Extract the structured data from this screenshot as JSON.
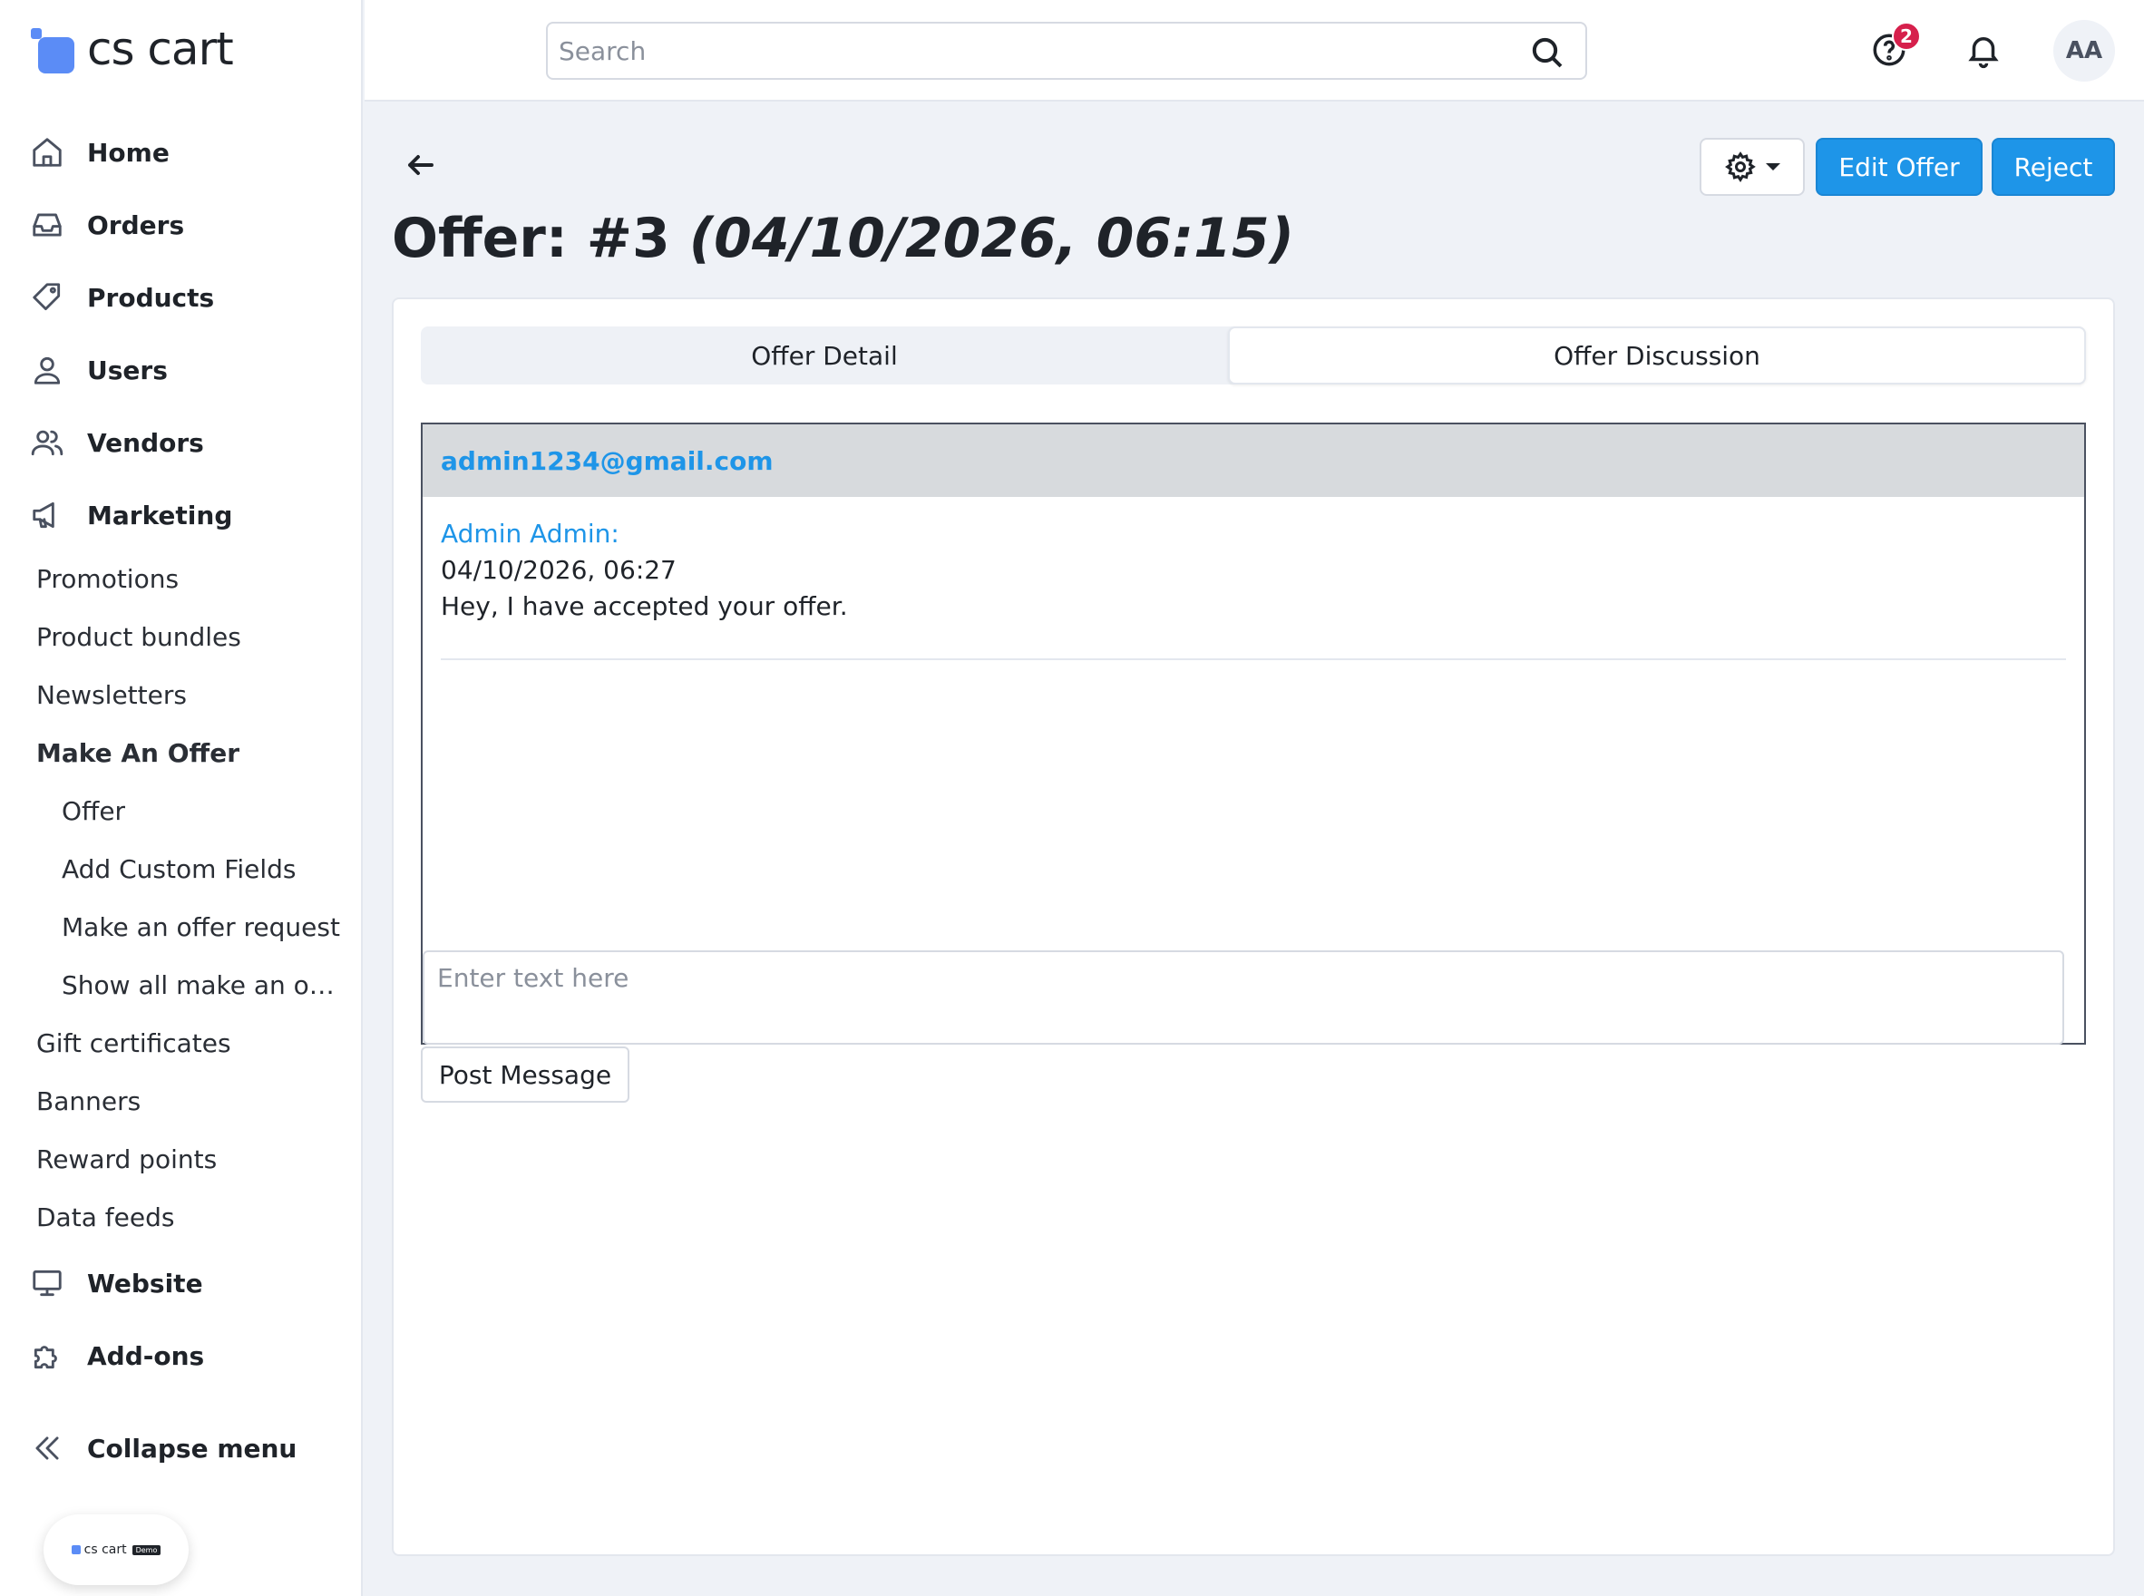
{
  "app": {
    "logo_text": "cs cart",
    "demo_logo_text": "cs cart",
    "demo_badge": "Demo"
  },
  "sidebar": {
    "main_items": [
      {
        "label": "Home",
        "icon": "home-icon"
      },
      {
        "label": "Orders",
        "icon": "inbox-icon"
      },
      {
        "label": "Products",
        "icon": "tag-icon"
      },
      {
        "label": "Users",
        "icon": "user-icon"
      },
      {
        "label": "Vendors",
        "icon": "users-icon"
      },
      {
        "label": "Marketing",
        "icon": "megaphone-icon"
      }
    ],
    "marketing_items": [
      "Promotions",
      "Product bundles",
      "Newsletters",
      "Make An Offer",
      "Gift certificates",
      "Banners",
      "Reward points",
      "Data feeds"
    ],
    "make_an_offer_items": [
      "Offer",
      "Add Custom Fields",
      "Make an offer request",
      "Show all make an offer requests"
    ],
    "bottom_items": [
      {
        "label": "Website",
        "icon": "monitor-icon"
      },
      {
        "label": "Add-ons",
        "icon": "puzzle-icon"
      }
    ],
    "collapse_label": "Collapse menu"
  },
  "topbar": {
    "search_placeholder": "Search",
    "help_badge_count": "2",
    "avatar_initials": "AA"
  },
  "header": {
    "title_prefix": "Offer: #3",
    "title_date": "(04/10/2026, 06:15)",
    "edit_label": "Edit Offer",
    "reject_label": "Reject"
  },
  "tabs": [
    {
      "label": "Offer Detail",
      "active": false
    },
    {
      "label": "Offer Discussion",
      "active": true
    }
  ],
  "discussion": {
    "email": "admin1234@gmail.com",
    "messages": [
      {
        "author": "Admin Admin:",
        "date": "04/10/2026, 06:27",
        "text": "Hey, I have accepted your offer."
      }
    ],
    "input_placeholder": "Enter text here",
    "post_label": "Post Message"
  },
  "colors": {
    "accent": "#1e95e8",
    "badge": "#d6204c",
    "logo": "#5b8cf6"
  }
}
